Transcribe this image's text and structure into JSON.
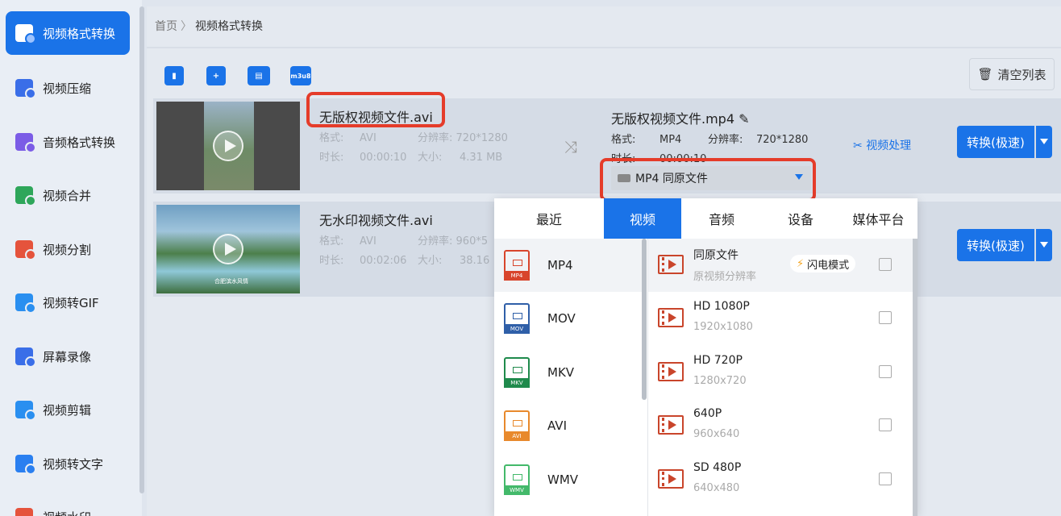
{
  "sidebar": {
    "items": [
      {
        "label": "视频格式转换",
        "color": "#1a73e8"
      },
      {
        "label": "视频压缩",
        "color": "#3a6ee8"
      },
      {
        "label": "音频格式转换",
        "color": "#7b5ce6"
      },
      {
        "label": "视频合并",
        "color": "#2ea65a"
      },
      {
        "label": "视频分割",
        "color": "#e5533c"
      },
      {
        "label": "视频转GIF",
        "color": "#2a8ff0"
      },
      {
        "label": "屏幕录像",
        "color": "#3a6ee8"
      },
      {
        "label": "视频剪辑",
        "color": "#2a8ff0"
      },
      {
        "label": "视频转文字",
        "color": "#2a7ff0"
      },
      {
        "label": "视频水印",
        "color": "#e5533c"
      }
    ]
  },
  "breadcrumb": {
    "home": "首页",
    "sep": "〉",
    "current": "视频格式转换"
  },
  "toolbar": {
    "m3u8_label": "m3u8",
    "clear_label": "清空列表"
  },
  "files": [
    {
      "name": "无版权视频文件.avi",
      "format_label": "格式:",
      "format": "AVI",
      "res_label": "分辨率:",
      "resolution": "720*1280",
      "duration_label": "时长:",
      "duration": "00:00:10",
      "size_label": "大小:",
      "size": "4.31 MB",
      "out_name": "无版权视频文件.mp4",
      "out_format_label": "格式:",
      "out_format": "MP4",
      "out_res_label": "分辨率:",
      "out_resolution": "720*1280",
      "out_duration_label": "时长:",
      "out_duration": "00:00:10",
      "select_value": "MP4  同原文件",
      "process_label": "视频处理",
      "convert_label": "转换(极速)"
    },
    {
      "name": "无水印视频文件.avi",
      "format_label": "格式:",
      "format": "AVI",
      "res_label": "分辨率:",
      "resolution": "960*5",
      "duration_label": "时长:",
      "duration": "00:02:06",
      "size_label": "大小:",
      "size": "38.16",
      "thumb_caption": "合肥滨水风情",
      "convert_label": "转换(极速)"
    }
  ],
  "popup": {
    "tabs": [
      "最近",
      "视频",
      "音频",
      "设备",
      "媒体平台"
    ],
    "active_tab": "视频",
    "formats": [
      {
        "label": "MP4",
        "color": "#d8452c"
      },
      {
        "label": "MOV",
        "color": "#2f5fa8"
      },
      {
        "label": "MKV",
        "color": "#1f8a4c"
      },
      {
        "label": "AVI",
        "color": "#e8892c"
      },
      {
        "label": "WMV",
        "color": "#43b96a"
      }
    ],
    "resolutions": [
      {
        "name": "同原文件",
        "sub": "原视频分辨率",
        "flash": "闪电模式"
      },
      {
        "name": "HD 1080P",
        "sub": "1920x1080"
      },
      {
        "name": "HD 720P",
        "sub": "1280x720"
      },
      {
        "name": "640P",
        "sub": "960x640"
      },
      {
        "name": "SD 480P",
        "sub": "640x480"
      }
    ]
  }
}
